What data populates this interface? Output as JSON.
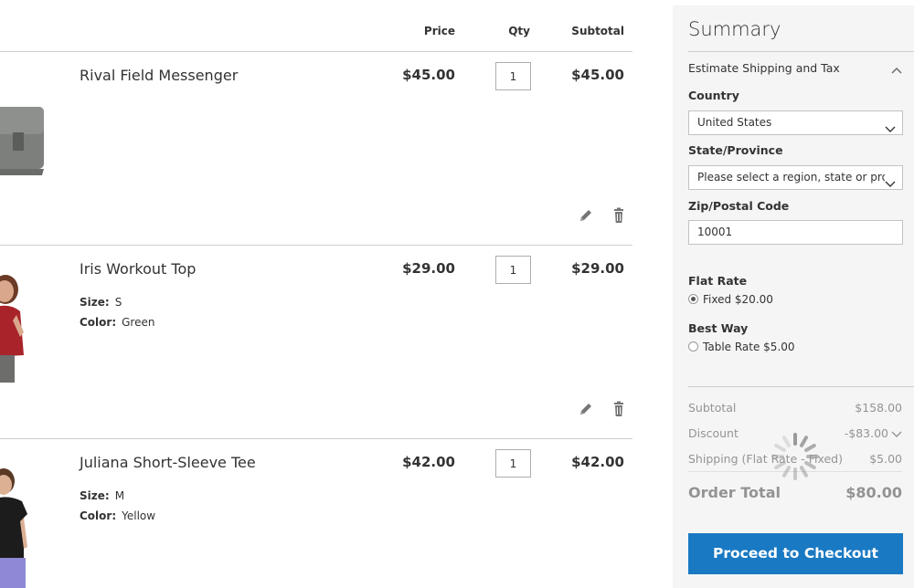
{
  "cart": {
    "columns": {
      "price": "Price",
      "qty": "Qty",
      "subtotal": "Subtotal"
    },
    "items": [
      {
        "name": "Rival Field Messenger",
        "price": "$45.00",
        "qty": "1",
        "subtotal": "$45.00",
        "options": []
      },
      {
        "name": "Iris Workout Top",
        "price": "$29.00",
        "qty": "1",
        "subtotal": "$29.00",
        "options": [
          {
            "label": "Size:",
            "value": "S"
          },
          {
            "label": "Color:",
            "value": "Green"
          }
        ]
      },
      {
        "name": "Juliana Short-Sleeve Tee",
        "price": "$42.00",
        "qty": "1",
        "subtotal": "$42.00",
        "options": [
          {
            "label": "Size:",
            "value": "M"
          },
          {
            "label": "Color:",
            "value": "Yellow"
          }
        ]
      }
    ]
  },
  "summary": {
    "title": "Summary",
    "estimate_title": "Estimate Shipping and Tax",
    "country_label": "Country",
    "country_value": "United States",
    "state_label": "State/Province",
    "state_value": "Please select a region, state or province.",
    "zip_label": "Zip/Postal Code",
    "zip_value": "10001",
    "methods": [
      {
        "title": "Flat Rate",
        "option": "Fixed $20.00",
        "selected": true
      },
      {
        "title": "Best Way",
        "option": "Table Rate $5.00",
        "selected": false
      }
    ],
    "totals": {
      "subtotal_label": "Subtotal",
      "subtotal_value": "$158.00",
      "discount_label": "Discount",
      "discount_value": "-$83.00",
      "shipping_label": "Shipping (Flat Rate - Fixed)",
      "shipping_value": "$5.00",
      "order_total_label": "Order Total",
      "order_total_value": "$80.00"
    },
    "checkout_label": "Proceed to Checkout"
  },
  "colors": {
    "accent": "#1979c3",
    "sidebar_bg": "#f5f5f5",
    "border": "#cccccc"
  },
  "icons": {
    "edit": "pencil-icon",
    "delete": "trash-icon",
    "collapse": "chevron-up-icon",
    "dropdown": "chevron-down-icon",
    "loading": "spinner-icon"
  }
}
